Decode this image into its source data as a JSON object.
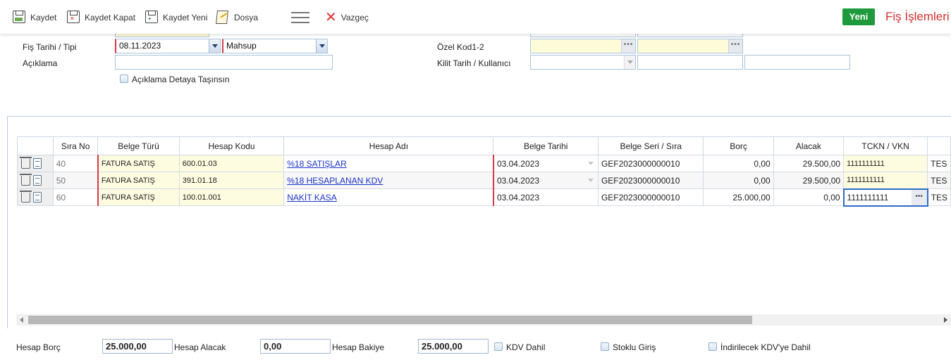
{
  "toolbar": {
    "kaydet": "Kaydet",
    "kaydet_kapat": "Kaydet Kapat",
    "kaydet_yeni": "Kaydet Yeni",
    "dosya": "Dosya",
    "vazgec": "Vazgeç",
    "yeni": "Yeni",
    "page_title": "Fiş İşlemleri"
  },
  "form": {
    "fis_tarihi_label": "Fiş Tarihi / Tipi",
    "fis_tarihi": "08.11.2023",
    "fis_tipi": "Mahsup",
    "aciklama_label": "Açıklama",
    "aciklama_value": "",
    "aciklama_detay_label": "Açıklama Detaya Taşınsın",
    "ozel_kod_label": "Özel Kod1-2",
    "kilit_label": "Kilit Tarih / Kullanıcı"
  },
  "grid": {
    "headers": [
      "Sıra No",
      "Belge Türü",
      "Hesap Kodu",
      "Hesap Adı",
      "Belge Tarihi",
      "Belge Seri / Sıra",
      "Borç",
      "Alacak",
      "TCKN / VKN"
    ],
    "rows": [
      {
        "sira": "40",
        "belge_turu": "FATURA SATIŞ",
        "hesap_kodu": "600.01.03",
        "hesap_adi": "%18 SATIŞLAR",
        "belge_tarihi": "03.04.2023",
        "belge_seri": "GEF2023000000010",
        "borc": "0,00",
        "alacak": "29.500,00",
        "tckn": "1111111111",
        "extra": "TES"
      },
      {
        "sira": "50",
        "belge_turu": "FATURA SATIŞ",
        "hesap_kodu": "391.01.18",
        "hesap_adi": "%18 HESAPLANAN KDV",
        "belge_tarihi": "03.04.2023",
        "belge_seri": "GEF2023000000010",
        "borc": "0,00",
        "alacak": "29.500,00",
        "tckn": "1111111111",
        "extra": "TES"
      },
      {
        "sira": "60",
        "belge_turu": "FATURA SATIŞ",
        "hesap_kodu": "100.01.001",
        "hesap_adi": "NAKİT KASA",
        "belge_tarihi": "03.04.2023",
        "belge_seri": "GEF2023000000010",
        "borc": "25.000,00",
        "alacak": "0,00",
        "tckn": "1111111111",
        "extra": "TES"
      }
    ]
  },
  "footer": {
    "hesap_borc_label": "Hesap Borç",
    "hesap_borc": "25.000,00",
    "hesap_alacak_label": "Hesap Alacak",
    "hesap_alacak": "0,00",
    "hesap_bakiye_label": "Hesap Bakiye",
    "hesap_bakiye": "25.000,00",
    "kdv_dahil_label": "KDV Dahil",
    "stoklu_giris_label": "Stoklu Giriş",
    "indirilecek_kdv_label": "İndirilecek KDV'ye Dahil"
  },
  "colors": {
    "accent_green": "#1e9a3c",
    "title_red": "#d32f2f",
    "link_blue": "#1a32c8",
    "required_red": "#d43c4b"
  }
}
